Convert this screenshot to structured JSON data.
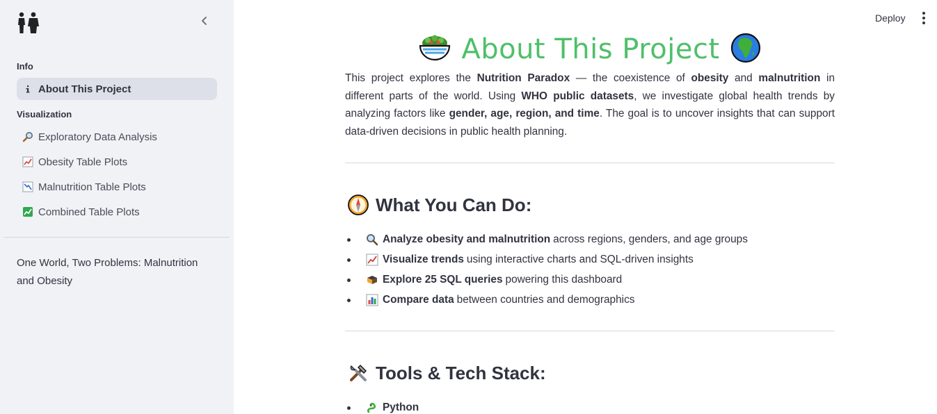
{
  "sidebar": {
    "logo_icon": "people-icon",
    "collapse_icon": "chevron-left-icon",
    "sections": {
      "info": "Info",
      "visualization": "Visualization"
    },
    "items": [
      {
        "label": "About This Project",
        "icon": "info-icon",
        "active": true
      },
      {
        "label": "Exploratory Data Analysis",
        "icon": "magnifier-icon"
      },
      {
        "label": "Obesity Table Plots",
        "icon": "chart-up-icon"
      },
      {
        "label": "Malnutrition Table Plots",
        "icon": "chart-down-icon"
      },
      {
        "label": "Combined Table Plots",
        "icon": "check-chart-icon"
      }
    ],
    "footer": "One World, Two Problems: Malnutrition and Obesity"
  },
  "header": {
    "deploy_label": "Deploy",
    "menu_icon": "more-vertical-icon"
  },
  "main": {
    "title": "About This Project",
    "title_left_icon": "salad-icon",
    "title_right_icon": "globe-africa-icon",
    "intro": {
      "p1": "This project explores the ",
      "b1": "Nutrition Paradox",
      "p2": " — the coexistence of ",
      "b2": "obesity",
      "p3": " and ",
      "b3": "malnutrition",
      "p4": " in different parts of the world. Using ",
      "b4": "WHO public datasets",
      "p5": ", we investigate global health trends by analyzing factors like ",
      "b5": "gender, age, region, and time",
      "p6": ". The goal is to uncover insights that can support data-driven decisions in public health planning."
    },
    "what_you_can_do": {
      "heading": "What You Can Do:",
      "icon": "compass-icon",
      "items": [
        {
          "icon": "magnifier-icon",
          "bold": "Analyze obesity and malnutrition",
          "text": "across regions, genders, and age groups"
        },
        {
          "icon": "chart-up-icon",
          "bold": "Visualize trends",
          "text": "using interactive charts and SQL-driven insights"
        },
        {
          "icon": "books-icon",
          "bold": "Explore 25 SQL queries",
          "text": "powering this dashboard"
        },
        {
          "icon": "bar-chart-icon",
          "bold": "Compare data",
          "text": "between countries and demographics"
        }
      ]
    },
    "tools": {
      "heading": "Tools & Tech Stack:",
      "icon": "tools-icon",
      "items": [
        {
          "icon": "snake-icon",
          "bold": "Python",
          "text": ""
        }
      ]
    }
  },
  "colors": {
    "sidebar_bg": "#f0f2f6",
    "active_item_bg": "#dde0e8",
    "title_green": "#4fbf6a",
    "text": "#31333f"
  }
}
